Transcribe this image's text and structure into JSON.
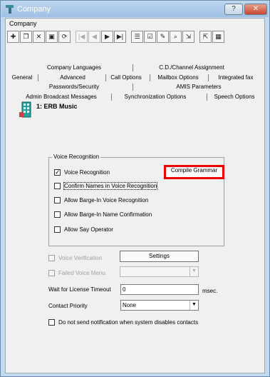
{
  "window": {
    "title": "Company",
    "help_button": "?",
    "close_button": "✕",
    "accent_color": "#e00000"
  },
  "menu": {
    "company": "Company"
  },
  "toolbar": {
    "buttons": [
      "add-icon",
      "copy-icon",
      "delete-icon",
      "save-icon",
      "refresh-icon",
      "first-icon",
      "prev-icon",
      "next-icon",
      "last-icon",
      "list-icon",
      "check-icon",
      "edit-icon",
      "find-icon",
      "import-icon",
      "export-icon",
      "grid-icon"
    ]
  },
  "tabs": {
    "row1": [
      "Company Languages",
      "C.D./Channel Assignment"
    ],
    "row2": [
      "General",
      "Advanced",
      "Call Options",
      "Mailbox Options",
      "Integrated fax"
    ],
    "row3": [
      "Passwords/Security",
      "AMIS Parameters"
    ],
    "row4": [
      "Admin Broadcast Messages",
      "Synchronization Options",
      "Speech Options"
    ]
  },
  "entity": {
    "label": "1: ERB Music"
  },
  "voice_group": {
    "title": "Voice Recognition",
    "voice_recognition": "Voice Recognition",
    "compile_grammar": "Compile Grammar",
    "confirm_names": "Confirm Names in Voice Recognition",
    "barge_in_voice": "Allow Barge-In Voice Recognition",
    "barge_in_name": "Allow Barge-In Name Confirmation",
    "say_operator": "Allow Say Operator"
  },
  "voice_verification": {
    "label": "Voice Verification",
    "settings_button": "Settings"
  },
  "failed_voice_menu": {
    "label": "Failed Voice Menu",
    "value": ""
  },
  "license_timeout": {
    "label": "Wait for License Timeout",
    "value": "0",
    "unit": "msec."
  },
  "contact_priority": {
    "label": "Contact Priority",
    "value": "None"
  },
  "no_notify": {
    "label": "Do not send notification when system disables contacts"
  }
}
